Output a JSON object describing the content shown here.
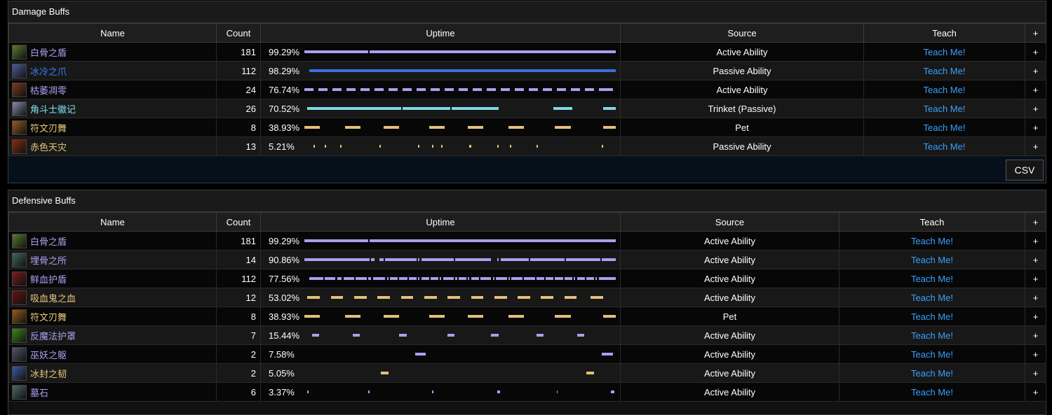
{
  "damage": {
    "title": "Damage Buffs",
    "headers": {
      "name": "Name",
      "count": "Count",
      "uptime": "Uptime",
      "source": "Source",
      "teach": "Teach",
      "plus": "+"
    },
    "csv_label": "CSV",
    "rows": [
      {
        "name": "白骨之盾",
        "count": "181",
        "uptime": "99.29%",
        "source": "Active Ability",
        "teach": "Teach Me!",
        "plus": "+",
        "name_color": "#a8a0f0",
        "bar_color": "#a8a0f0",
        "icon_color": "#5b7a2e",
        "segments": [
          [
            0,
            0.205
          ],
          [
            0.21,
            1.0
          ]
        ]
      },
      {
        "name": "冰冷之爪",
        "count": "112",
        "uptime": "98.29%",
        "source": "Passive Ability",
        "teach": "Teach Me!",
        "plus": "+",
        "name_color": "#3b7dff",
        "bar_color": "#3b6fe0",
        "icon_color": "#4a5e9a",
        "segments": [
          [
            0.015,
            1.0
          ]
        ]
      },
      {
        "name": "枯萎凋零",
        "count": "24",
        "uptime": "76.74%",
        "source": "Active Ability",
        "teach": "Teach Me!",
        "plus": "+",
        "name_color": "#a8a0f0",
        "bar_color": "#a8a0f0",
        "icon_color": "#7a3a22",
        "segments": [
          [
            0,
            0.03
          ],
          [
            0.045,
            0.075
          ],
          [
            0.09,
            0.12
          ],
          [
            0.135,
            0.165
          ],
          [
            0.18,
            0.21
          ],
          [
            0.225,
            0.255
          ],
          [
            0.27,
            0.3
          ],
          [
            0.315,
            0.345
          ],
          [
            0.36,
            0.39
          ],
          [
            0.405,
            0.435
          ],
          [
            0.45,
            0.48
          ],
          [
            0.495,
            0.525
          ],
          [
            0.54,
            0.57
          ],
          [
            0.585,
            0.615
          ],
          [
            0.63,
            0.66
          ],
          [
            0.675,
            0.705
          ],
          [
            0.72,
            0.75
          ],
          [
            0.765,
            0.795
          ],
          [
            0.81,
            0.84
          ],
          [
            0.855,
            0.885
          ],
          [
            0.9,
            0.93
          ],
          [
            0.945,
            0.99
          ]
        ]
      },
      {
        "name": "角斗士徽记",
        "count": "26",
        "uptime": "70.52%",
        "source": "Trinket (Passive)",
        "teach": "Teach Me!",
        "plus": "+",
        "name_color": "#7fe3ee",
        "bar_color": "#7fd8e8",
        "icon_color": "#8a8ab0",
        "segments": [
          [
            0.008,
            0.31
          ],
          [
            0.316,
            0.468
          ],
          [
            0.472,
            0.625
          ],
          [
            0.8,
            0.86
          ],
          [
            0.96,
            1.0
          ]
        ]
      },
      {
        "name": "符文刃舞",
        "count": "8",
        "uptime": "38.93%",
        "source": "Pet",
        "teach": "Teach Me!",
        "plus": "+",
        "name_color": "#e8c87a",
        "bar_color": "#e3c07a",
        "icon_color": "#9a5a1a",
        "segments": [
          [
            0,
            0.05
          ],
          [
            0.13,
            0.18
          ],
          [
            0.255,
            0.305
          ],
          [
            0.4,
            0.45
          ],
          [
            0.525,
            0.575
          ],
          [
            0.655,
            0.705
          ],
          [
            0.805,
            0.855
          ],
          [
            0.96,
            1.0
          ]
        ]
      },
      {
        "name": "赤色天灾",
        "count": "13",
        "uptime": "5.21%",
        "source": "Passive Ability",
        "teach": "Teach Me!",
        "plus": "+",
        "name_color": "#e8c87a",
        "bar_color": "#e3c07a",
        "icon_color": "#8a2a10",
        "segments": [
          [
            0.03,
            0.034
          ],
          [
            0.065,
            0.069
          ],
          [
            0.115,
            0.118
          ],
          [
            0.24,
            0.245
          ],
          [
            0.365,
            0.368
          ],
          [
            0.41,
            0.413
          ],
          [
            0.44,
            0.443
          ],
          [
            0.53,
            0.535
          ],
          [
            0.62,
            0.623
          ],
          [
            0.66,
            0.664
          ],
          [
            0.745,
            0.749
          ],
          [
            0.955,
            0.959
          ]
        ]
      }
    ]
  },
  "defensive": {
    "title": "Defensive Buffs",
    "headers": {
      "name": "Name",
      "count": "Count",
      "uptime": "Uptime",
      "source": "Source",
      "teach": "Teach",
      "plus": "+"
    },
    "rows": [
      {
        "name": "白骨之盾",
        "count": "181",
        "uptime": "99.29%",
        "source": "Active Ability",
        "teach": "Teach Me!",
        "plus": "+",
        "name_color": "#a8a0f0",
        "bar_color": "#a8a0f0",
        "icon_color": "#5b7a2e",
        "segments": [
          [
            0,
            0.205
          ],
          [
            0.21,
            1.0
          ]
        ]
      },
      {
        "name": "埋骨之所",
        "count": "14",
        "uptime": "90.86%",
        "source": "Active Ability",
        "teach": "Teach Me!",
        "plus": "+",
        "name_color": "#a8a0f0",
        "bar_color": "#a8a0f0",
        "icon_color": "#3e6a5a",
        "segments": [
          [
            0,
            0.21
          ],
          [
            0.215,
            0.225
          ],
          [
            0.24,
            0.255
          ],
          [
            0.26,
            0.36
          ],
          [
            0.365,
            0.37
          ],
          [
            0.375,
            0.48
          ],
          [
            0.485,
            0.6
          ],
          [
            0.62,
            0.625
          ],
          [
            0.63,
            0.72
          ],
          [
            0.725,
            0.835
          ],
          [
            0.84,
            0.95
          ],
          [
            0.955,
            1.0
          ]
        ]
      },
      {
        "name": "鲜血护盾",
        "count": "112",
        "uptime": "77.56%",
        "source": "Active Ability",
        "teach": "Teach Me!",
        "plus": "+",
        "name_color": "#a8a0f0",
        "bar_color": "#a8a0f0",
        "icon_color": "#7a1a1a",
        "segments": [
          [
            0.015,
            0.06
          ],
          [
            0.065,
            0.1
          ],
          [
            0.105,
            0.12
          ],
          [
            0.125,
            0.16
          ],
          [
            0.165,
            0.2
          ],
          [
            0.205,
            0.215
          ],
          [
            0.22,
            0.26
          ],
          [
            0.265,
            0.27
          ],
          [
            0.275,
            0.3
          ],
          [
            0.305,
            0.33
          ],
          [
            0.335,
            0.36
          ],
          [
            0.365,
            0.37
          ],
          [
            0.375,
            0.4
          ],
          [
            0.405,
            0.43
          ],
          [
            0.435,
            0.44
          ],
          [
            0.445,
            0.48
          ],
          [
            0.485,
            0.49
          ],
          [
            0.495,
            0.52
          ],
          [
            0.525,
            0.53
          ],
          [
            0.535,
            0.56
          ],
          [
            0.565,
            0.6
          ],
          [
            0.605,
            0.61
          ],
          [
            0.615,
            0.65
          ],
          [
            0.655,
            0.66
          ],
          [
            0.665,
            0.7
          ],
          [
            0.705,
            0.74
          ],
          [
            0.745,
            0.77
          ],
          [
            0.775,
            0.8
          ],
          [
            0.805,
            0.83
          ],
          [
            0.835,
            0.86
          ],
          [
            0.865,
            0.87
          ],
          [
            0.875,
            0.9
          ],
          [
            0.905,
            0.93
          ],
          [
            0.935,
            0.94
          ],
          [
            0.945,
            1.0
          ]
        ]
      },
      {
        "name": "吸血鬼之血",
        "count": "12",
        "uptime": "53.02%",
        "source": "Active Ability",
        "teach": "Teach Me!",
        "plus": "+",
        "name_color": "#e8c87a",
        "bar_color": "#e3c07a",
        "icon_color": "#6a1010",
        "segments": [
          [
            0.01,
            0.05
          ],
          [
            0.085,
            0.125
          ],
          [
            0.16,
            0.2
          ],
          [
            0.235,
            0.275
          ],
          [
            0.31,
            0.35
          ],
          [
            0.385,
            0.425
          ],
          [
            0.46,
            0.5
          ],
          [
            0.535,
            0.575
          ],
          [
            0.61,
            0.65
          ],
          [
            0.685,
            0.725
          ],
          [
            0.76,
            0.8
          ],
          [
            0.835,
            0.875
          ],
          [
            0.92,
            0.96
          ]
        ]
      },
      {
        "name": "符文刃舞",
        "count": "8",
        "uptime": "38.93%",
        "source": "Pet",
        "teach": "Teach Me!",
        "plus": "+",
        "name_color": "#e8c87a",
        "bar_color": "#e3c07a",
        "icon_color": "#9a5a1a",
        "segments": [
          [
            0,
            0.05
          ],
          [
            0.13,
            0.18
          ],
          [
            0.255,
            0.305
          ],
          [
            0.4,
            0.45
          ],
          [
            0.525,
            0.575
          ],
          [
            0.655,
            0.705
          ],
          [
            0.805,
            0.855
          ],
          [
            0.96,
            1.0
          ]
        ]
      },
      {
        "name": "反魔法护罩",
        "count": "7",
        "uptime": "15.44%",
        "source": "Active Ability",
        "teach": "Teach Me!",
        "plus": "+",
        "name_color": "#a8a0f0",
        "bar_color": "#a8a0f0",
        "icon_color": "#3a8a1a",
        "segments": [
          [
            0.025,
            0.048
          ],
          [
            0.155,
            0.178
          ],
          [
            0.305,
            0.328
          ],
          [
            0.46,
            0.483
          ],
          [
            0.6,
            0.623
          ],
          [
            0.745,
            0.768
          ],
          [
            0.875,
            0.898
          ]
        ]
      },
      {
        "name": "巫妖之躯",
        "count": "2",
        "uptime": "7.58%",
        "source": "Active Ability",
        "teach": "Teach Me!",
        "plus": "+",
        "name_color": "#a8a0f0",
        "bar_color": "#a8a0f0",
        "icon_color": "#555566",
        "segments": [
          [
            0.355,
            0.39
          ],
          [
            0.955,
            0.99
          ]
        ]
      },
      {
        "name": "冰封之韧",
        "count": "2",
        "uptime": "5.05%",
        "source": "Active Ability",
        "teach": "Teach Me!",
        "plus": "+",
        "name_color": "#e8c87a",
        "bar_color": "#e3c07a",
        "icon_color": "#3a5aa0",
        "segments": [
          [
            0.245,
            0.27
          ],
          [
            0.905,
            0.93
          ]
        ]
      },
      {
        "name": "墓石",
        "count": "6",
        "uptime": "3.37%",
        "source": "Active Ability",
        "teach": "Teach Me!",
        "plus": "+",
        "name_color": "#a8a0f0",
        "bar_color": "#a8a0f0",
        "icon_color": "#4a6a6a",
        "segments": [
          [
            0.01,
            0.013
          ],
          [
            0.205,
            0.208
          ],
          [
            0.41,
            0.413
          ],
          [
            0.62,
            0.628
          ],
          [
            0.81,
            0.813
          ],
          [
            0.985,
            0.995
          ]
        ]
      }
    ]
  }
}
